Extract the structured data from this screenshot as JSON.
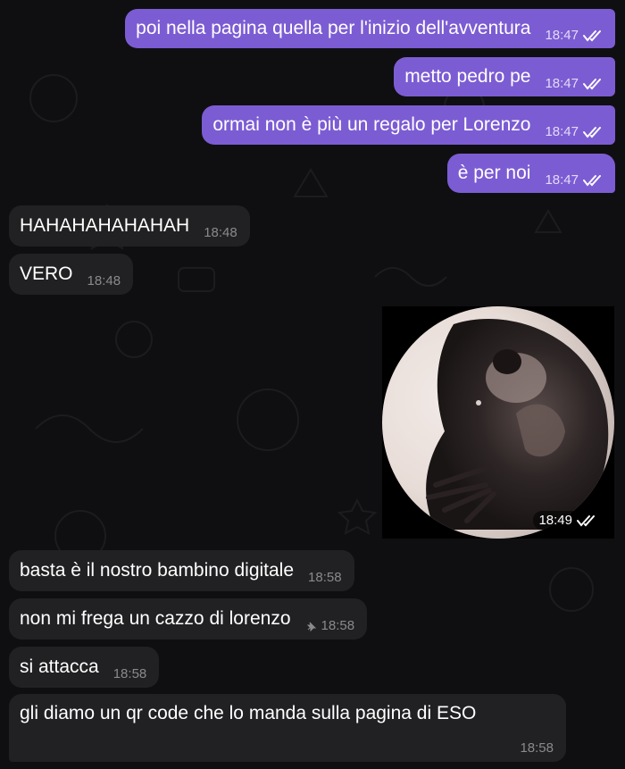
{
  "colors": {
    "background": "#0f0f11",
    "outgoing_bubble": "#7c5cd3",
    "incoming_bubble": "#212123",
    "read_checks": "#ffffff"
  },
  "messages": [
    {
      "text": "poi nella pagina quella per l'inizio dell'avventura",
      "time": "18:47",
      "status": "read-double-check-icon"
    },
    {
      "text": "metto pedro pe",
      "time": "18:47",
      "status": "read-double-check-icon"
    },
    {
      "text": "ormai non è più un regalo per Lorenzo",
      "time": "18:47",
      "status": "read-double-check-icon"
    },
    {
      "text": "è per noi",
      "time": "18:47",
      "status": "read-double-check-icon"
    },
    {
      "text": "HAHAHAHAHAHAH",
      "time": "18:48"
    },
    {
      "text": "VERO",
      "time": "18:48"
    },
    {
      "video_time": "18:49",
      "status": "read-double-check-icon"
    },
    {
      "text": "basta è il nostro bambino digitale",
      "time": "18:58"
    },
    {
      "text": "non mi frega un cazzo di lorenzo",
      "time": "18:58",
      "pinned": "pin-icon"
    },
    {
      "text": "si attacca",
      "time": "18:58"
    },
    {
      "text": "gli diamo un qr code che lo manda sulla pagina di ESO",
      "time": "18:58"
    }
  ]
}
